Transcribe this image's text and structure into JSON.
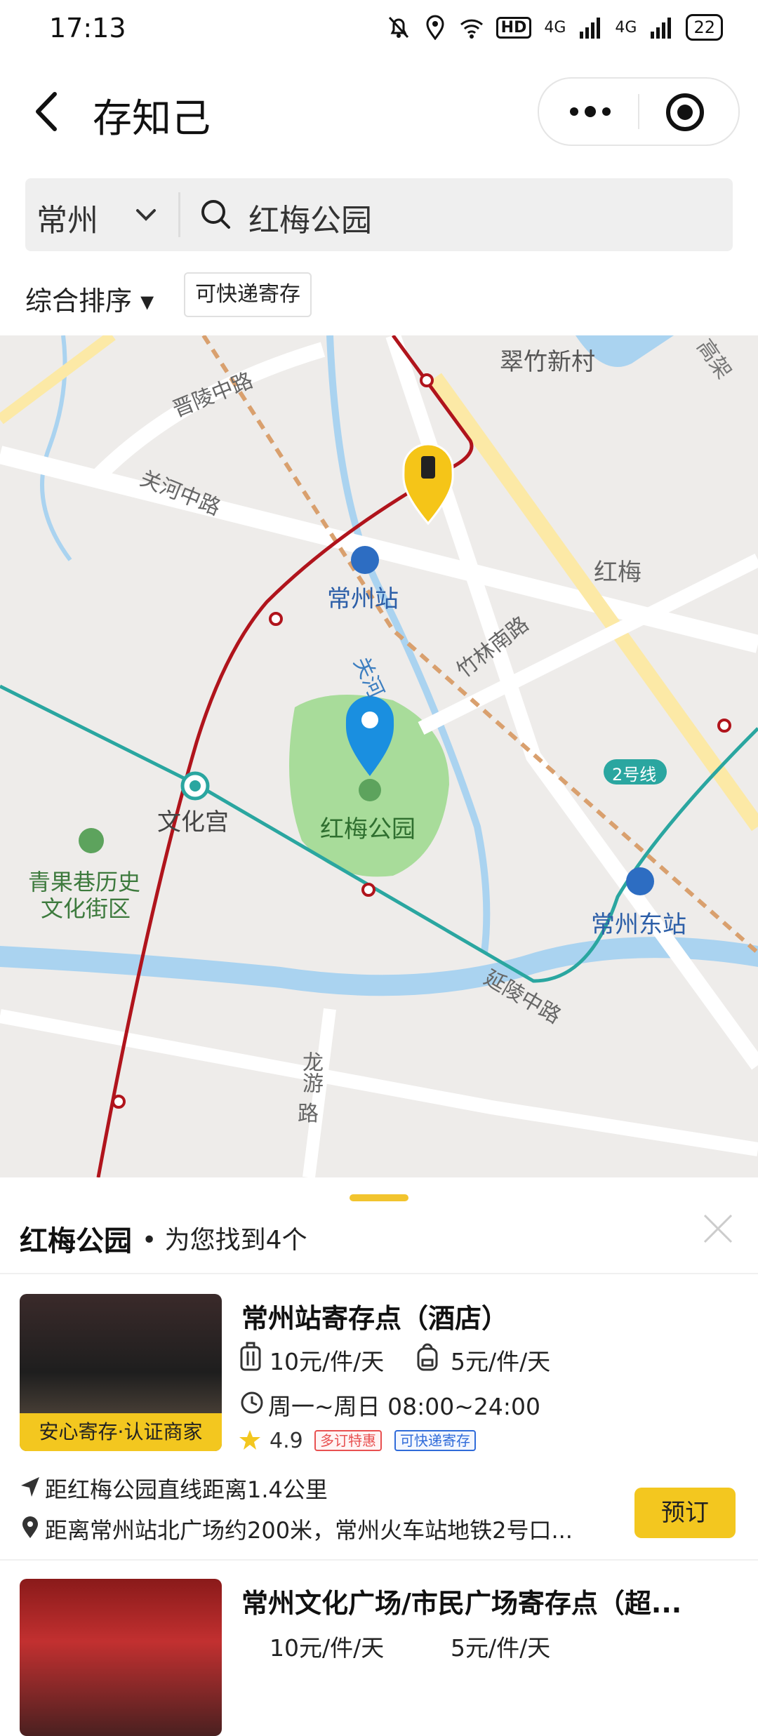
{
  "status_bar": {
    "time": "17:13",
    "network1": "4G",
    "network2": "4G",
    "battery": "22",
    "hd": "HD"
  },
  "nav": {
    "title": "存知己"
  },
  "search": {
    "city": "常州",
    "query": "红梅公园"
  },
  "filters": {
    "sort_label": "综合排序 ▾",
    "chip_label": "可快递寄存"
  },
  "map": {
    "labels": {
      "cuizhu": "翠竹新村",
      "jinling": "晋陵中路",
      "guanhe_road": "关河中路",
      "changzhou_station": "常州站",
      "hongmei": "红梅",
      "guanhe": "关河",
      "zhulin": "竹林南路",
      "line2": "2号线",
      "wenhuagong": "文化宫",
      "hongmei_park": "红梅公园",
      "qingguo": "青果巷历史",
      "qingguo2": "文化街区",
      "east_station": "常州东站",
      "yanling": "延陵中路",
      "longyou": "龙游",
      "longyou2": "路",
      "gaojia": "高架"
    }
  },
  "sheet": {
    "title": "红梅公园",
    "subtitle": "• 为您找到4个",
    "cards": [
      {
        "title": "常州站寄存点（酒店）",
        "price_large": "10元/件/天",
        "price_small": "5元/件/天",
        "hours": "周一~周日 08:00~24:00",
        "rating": "4.9",
        "tag1": "多订特惠",
        "tag2": "可快递寄存",
        "badge": "安心寄存·认证商家",
        "distance": "距红梅公园直线距离1.4公里",
        "address": "距离常州站北广场约200米，常州火车站地铁2号口...",
        "book": "预订"
      },
      {
        "title": "常州文化广场/市民广场寄存点（超...",
        "price_large": "10元/件/天",
        "price_small": "5元/件/天"
      }
    ]
  },
  "colors": {
    "accent": "#f3c71f",
    "metro_red": "#b0141c",
    "metro_teal": "#2aa6a0",
    "park": "#a8dc9a",
    "water": "#aad3f0"
  }
}
